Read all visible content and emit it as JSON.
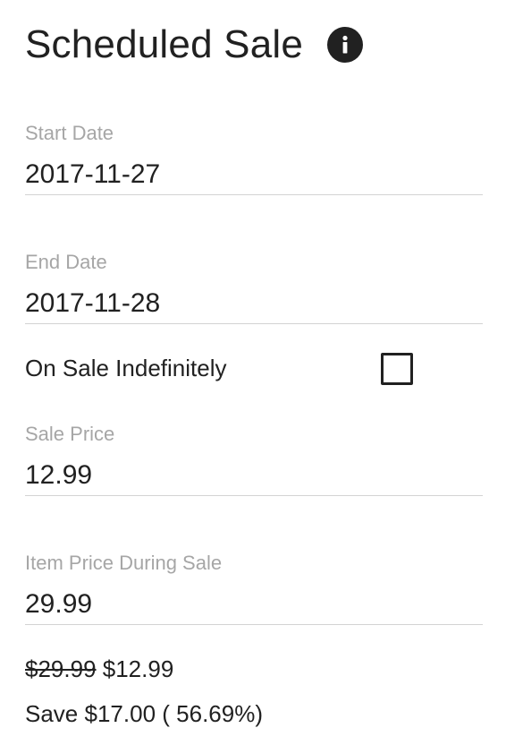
{
  "header": {
    "title": "Scheduled Sale",
    "info_icon": "info-icon"
  },
  "form": {
    "start_date": {
      "label": "Start Date",
      "value": "2017-11-27"
    },
    "end_date": {
      "label": "End Date",
      "value": "2017-11-28"
    },
    "indefinite": {
      "label": "On Sale Indefinitely",
      "checked": false
    },
    "sale_price": {
      "label": "Sale Price",
      "value": "12.99"
    },
    "item_price": {
      "label": "Item Price During Sale",
      "value": "29.99"
    }
  },
  "summary": {
    "original_price": "$29.99",
    "sale_price": "$12.99",
    "save_prefix": "Save",
    "save_amount": "$17.00",
    "save_percent": "( 56.69%)"
  }
}
